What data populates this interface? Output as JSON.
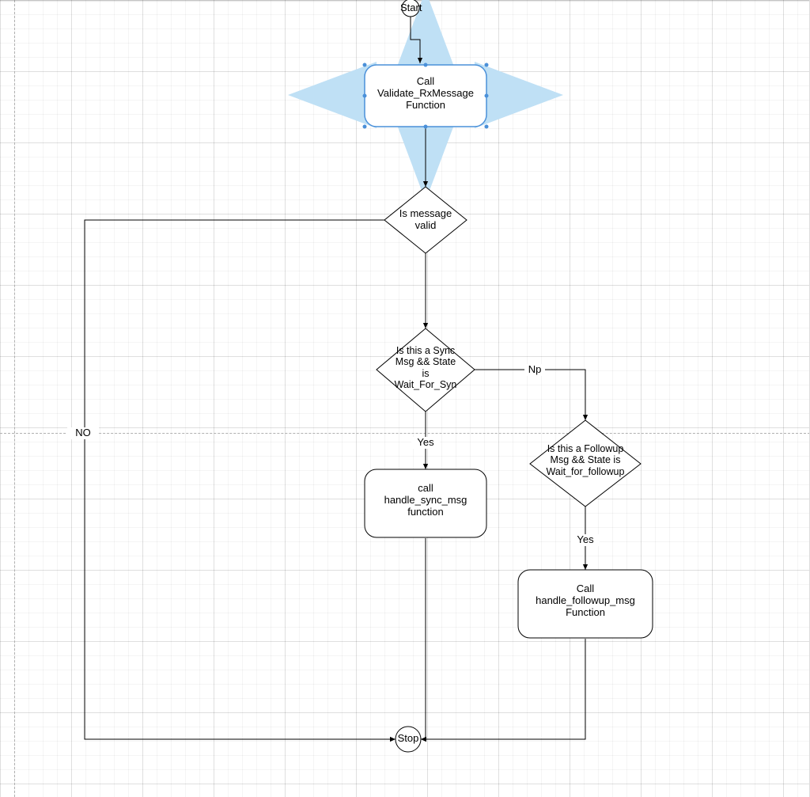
{
  "nodes": {
    "start": {
      "label": "Start"
    },
    "validate": {
      "label": "Call\nValidate_RxMessage\nFunction"
    },
    "is_valid": {
      "label": "Is message\nvalid"
    },
    "is_sync": {
      "label": "Is this a Sync\nMsg && State\nis\nWait_For_Syn"
    },
    "handle_sync": {
      "label": "call\nhandle_sync_msg\nfunction"
    },
    "is_followup": {
      "label": "Is this a Followup\nMsg && State is\nWait_for_followup"
    },
    "handle_followup": {
      "label": "Call\nhandle_followup_msg\nFunction"
    },
    "stop": {
      "label": "Stop"
    }
  },
  "edge_labels": {
    "no_valid": "NO",
    "np": "Np",
    "yes_sync": "Yes",
    "yes_followup": "Yes"
  },
  "chart_data": {
    "type": "flowchart",
    "nodes": [
      {
        "id": "start",
        "kind": "terminator",
        "label": "Start"
      },
      {
        "id": "validate",
        "kind": "process",
        "label": "Call Validate_RxMessage Function"
      },
      {
        "id": "is_valid",
        "kind": "decision",
        "label": "Is message valid"
      },
      {
        "id": "is_sync",
        "kind": "decision",
        "label": "Is this a Sync Msg && State is Wait_For_Syn"
      },
      {
        "id": "handle_sync",
        "kind": "process",
        "label": "call handle_sync_msg function"
      },
      {
        "id": "is_followup",
        "kind": "decision",
        "label": "Is this a Followup Msg && State is Wait_for_followup"
      },
      {
        "id": "handle_followup",
        "kind": "process",
        "label": "Call handle_followup_msg Function"
      },
      {
        "id": "stop",
        "kind": "terminator",
        "label": "Stop"
      }
    ],
    "edges": [
      {
        "from": "start",
        "to": "validate"
      },
      {
        "from": "validate",
        "to": "is_valid"
      },
      {
        "from": "is_valid",
        "to": "stop",
        "label": "NO"
      },
      {
        "from": "is_valid",
        "to": "is_sync"
      },
      {
        "from": "is_sync",
        "to": "handle_sync",
        "label": "Yes"
      },
      {
        "from": "is_sync",
        "to": "is_followup",
        "label": "Np"
      },
      {
        "from": "handle_sync",
        "to": "stop"
      },
      {
        "from": "is_followup",
        "to": "handle_followup",
        "label": "Yes"
      },
      {
        "from": "handle_followup",
        "to": "stop"
      }
    ]
  }
}
